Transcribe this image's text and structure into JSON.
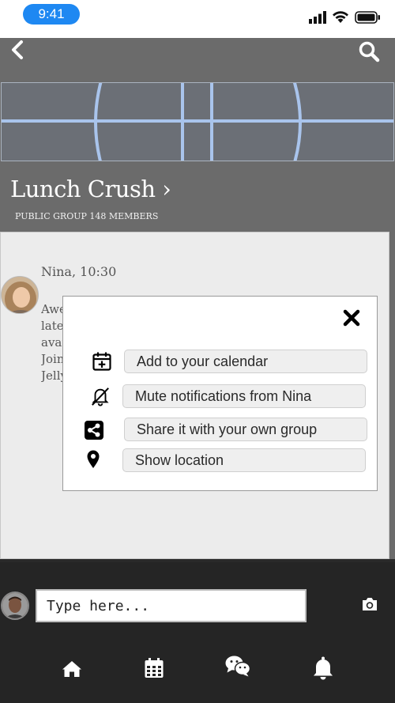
{
  "status_bar": {
    "time": "9:41"
  },
  "header": {
    "back_icon": "chevron-left-icon",
    "search_icon": "search-icon",
    "group_title": "Lunch Crush",
    "title_chevron": "›",
    "group_meta": "PUBLIC GROUP 148 MEMBERS"
  },
  "message": {
    "author_time": "Nina, 10:30",
    "text_lines": [
      "Awe",
      "late",
      "avai",
      "Join",
      "Jelly"
    ]
  },
  "popup": {
    "close_icon": "close-icon",
    "items": [
      {
        "icon": "calendar-plus-icon",
        "label": "Add to your calendar"
      },
      {
        "icon": "bell-slash-icon",
        "label": "Mute notifications from Nina"
      },
      {
        "icon": "share-icon",
        "label": "Share it with your own group"
      },
      {
        "icon": "map-pin-icon",
        "label": "Show location"
      }
    ]
  },
  "composer": {
    "input_value": "Type here...",
    "camera_icon": "camera-icon"
  },
  "nav": {
    "items": [
      "home-icon",
      "calendar-icon",
      "chat-icon",
      "bell-icon"
    ]
  },
  "colors": {
    "status_pill": "#1e88f2",
    "header_bg": "#6b6b6b",
    "cover_lines": "#a9c4ec",
    "content_bg": "#ececec",
    "bottom_bg": "#252525"
  }
}
